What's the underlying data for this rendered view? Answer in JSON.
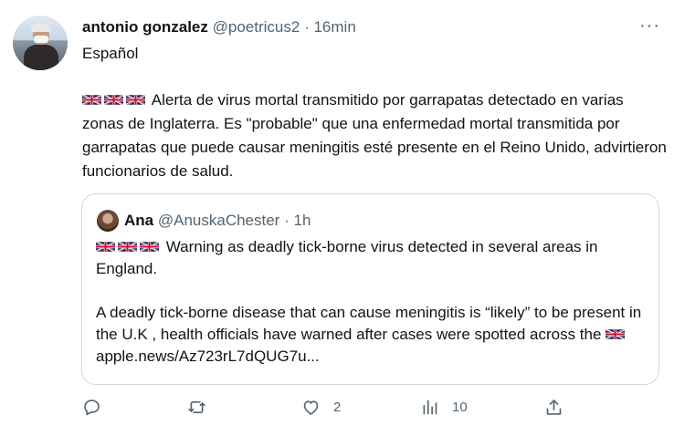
{
  "tweet": {
    "author_name": "antonio gonzalez",
    "author_handle": "@poetricus2",
    "separator": "·",
    "time": "16min",
    "language_label": "Español",
    "text": "Alerta de virus mortal transmitido por garrapatas detectado en varias zonas de Inglaterra. Es \"probable\" que una enfermedad mortal transmitida por garrapatas que puede causar meningitis esté presente en el Reino Unido, advirtieron funcionarios de salud.",
    "more_label": "···"
  },
  "quoted_tweet": {
    "author_name": "Ana",
    "author_handle": "@AnuskaChester",
    "separator": "·",
    "time": "1h",
    "paragraph1": "Warning as deadly tick-borne virus detected in several areas in England.",
    "paragraph2_start": "A deadly tick-borne disease that can cause meningitis is “likely” to be present in the U.K , health officials have warned after cases were spotted across the",
    "link": "apple.news/Az723rL7dQUG7u..."
  },
  "actions": {
    "reply_count": "",
    "retweet_count": "",
    "like_count": "2",
    "views_count": "10"
  },
  "icons": [
    "uk-flag-icon",
    "more-icon",
    "reply-icon",
    "retweet-icon",
    "like-icon",
    "views-icon",
    "share-icon"
  ],
  "colors": {
    "secondary_text": "#536471",
    "border": "#cfd9de",
    "flag_blue": "#012169",
    "flag_red": "#C8102E"
  }
}
